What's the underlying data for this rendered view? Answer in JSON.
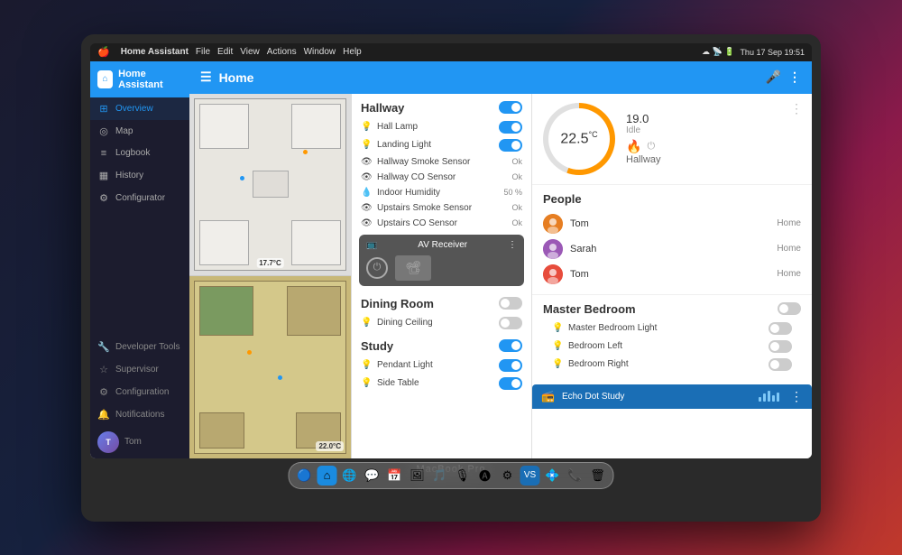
{
  "macbook": {
    "label": "MacBook Pro"
  },
  "menubar": {
    "app": "Home Assistant",
    "menus": [
      "File",
      "Edit",
      "View",
      "Actions",
      "Window",
      "Help"
    ],
    "time": "Thu 17 Sep 19:51"
  },
  "sidebar": {
    "title": "Home Assistant",
    "nav_items": [
      {
        "id": "overview",
        "label": "Overview",
        "icon": "⊞",
        "active": true
      },
      {
        "id": "map",
        "label": "Map",
        "icon": "◎"
      },
      {
        "id": "logbook",
        "label": "Logbook",
        "icon": "≡"
      },
      {
        "id": "history",
        "label": "History",
        "icon": "▦"
      },
      {
        "id": "configurator",
        "label": "Configurator",
        "icon": "⚙"
      }
    ],
    "bottom_items": [
      {
        "id": "developer",
        "label": "Developer Tools",
        "icon": "🔧"
      },
      {
        "id": "supervisor",
        "label": "Supervisor",
        "icon": "☆"
      },
      {
        "id": "configuration",
        "label": "Configuration",
        "icon": "⚙"
      },
      {
        "id": "notifications",
        "label": "Notifications",
        "icon": "🔔"
      }
    ],
    "user": "Tom"
  },
  "header": {
    "title": "Home",
    "mic_icon": "🎤"
  },
  "hallway": {
    "title": "Hallway",
    "devices": [
      {
        "name": "Hall Lamp",
        "icon": "💡",
        "state": "on",
        "type": "toggle"
      },
      {
        "name": "Landing Light",
        "icon": "💡",
        "state": "on",
        "type": "toggle"
      },
      {
        "name": "Hallway Smoke Sensor",
        "icon": "👁",
        "state": "Ok",
        "type": "value"
      },
      {
        "name": "Hallway CO Sensor",
        "icon": "👁",
        "state": "Ok",
        "type": "value"
      },
      {
        "name": "Indoor Humidity",
        "icon": "💧",
        "state": "50 %",
        "type": "value"
      },
      {
        "name": "Upstairs Smoke Sensor",
        "icon": "👁",
        "state": "Ok",
        "type": "value"
      },
      {
        "name": "Upstairs CO Sensor",
        "icon": "👁",
        "state": "Ok",
        "type": "value"
      }
    ]
  },
  "av_receiver": {
    "title": "AV Receiver",
    "state": "off"
  },
  "dining_room": {
    "title": "Dining Room",
    "state": "off",
    "devices": [
      {
        "name": "Dining Ceiling",
        "icon": "💡",
        "state": "off",
        "type": "toggle"
      }
    ]
  },
  "study": {
    "title": "Study",
    "state": "on",
    "devices": [
      {
        "name": "Pendant Light",
        "icon": "💡",
        "state": "on",
        "type": "toggle"
      },
      {
        "name": "Side Table",
        "icon": "💡",
        "state": "on",
        "type": "toggle"
      }
    ]
  },
  "thermostat": {
    "temperature": "22.5",
    "unit": "°C",
    "target": "19.0",
    "status": "Idle",
    "name": "Hallway"
  },
  "people": {
    "title": "People",
    "list": [
      {
        "name": "Tom",
        "status": "Home",
        "color": "#e67e22"
      },
      {
        "name": "Sarah",
        "status": "Home",
        "color": "#9b59b6"
      },
      {
        "name": "Tom",
        "status": "Home",
        "color": "#e74c3c"
      }
    ]
  },
  "master_bedroom": {
    "title": "Master Bedroom",
    "devices": [
      {
        "name": "Master Bedroom Light",
        "icon": "💡",
        "state": "off",
        "type": "toggle"
      },
      {
        "name": "Bedroom Left",
        "icon": "💡",
        "state": "off",
        "type": "toggle"
      },
      {
        "name": "Bedroom Right",
        "icon": "💡",
        "state": "off",
        "type": "toggle"
      }
    ]
  },
  "echo_dot": {
    "title": "Echo Dot Study"
  },
  "floor_plan": {
    "top_temp": "17.7°C",
    "bottom_temp": "22.0°C"
  }
}
